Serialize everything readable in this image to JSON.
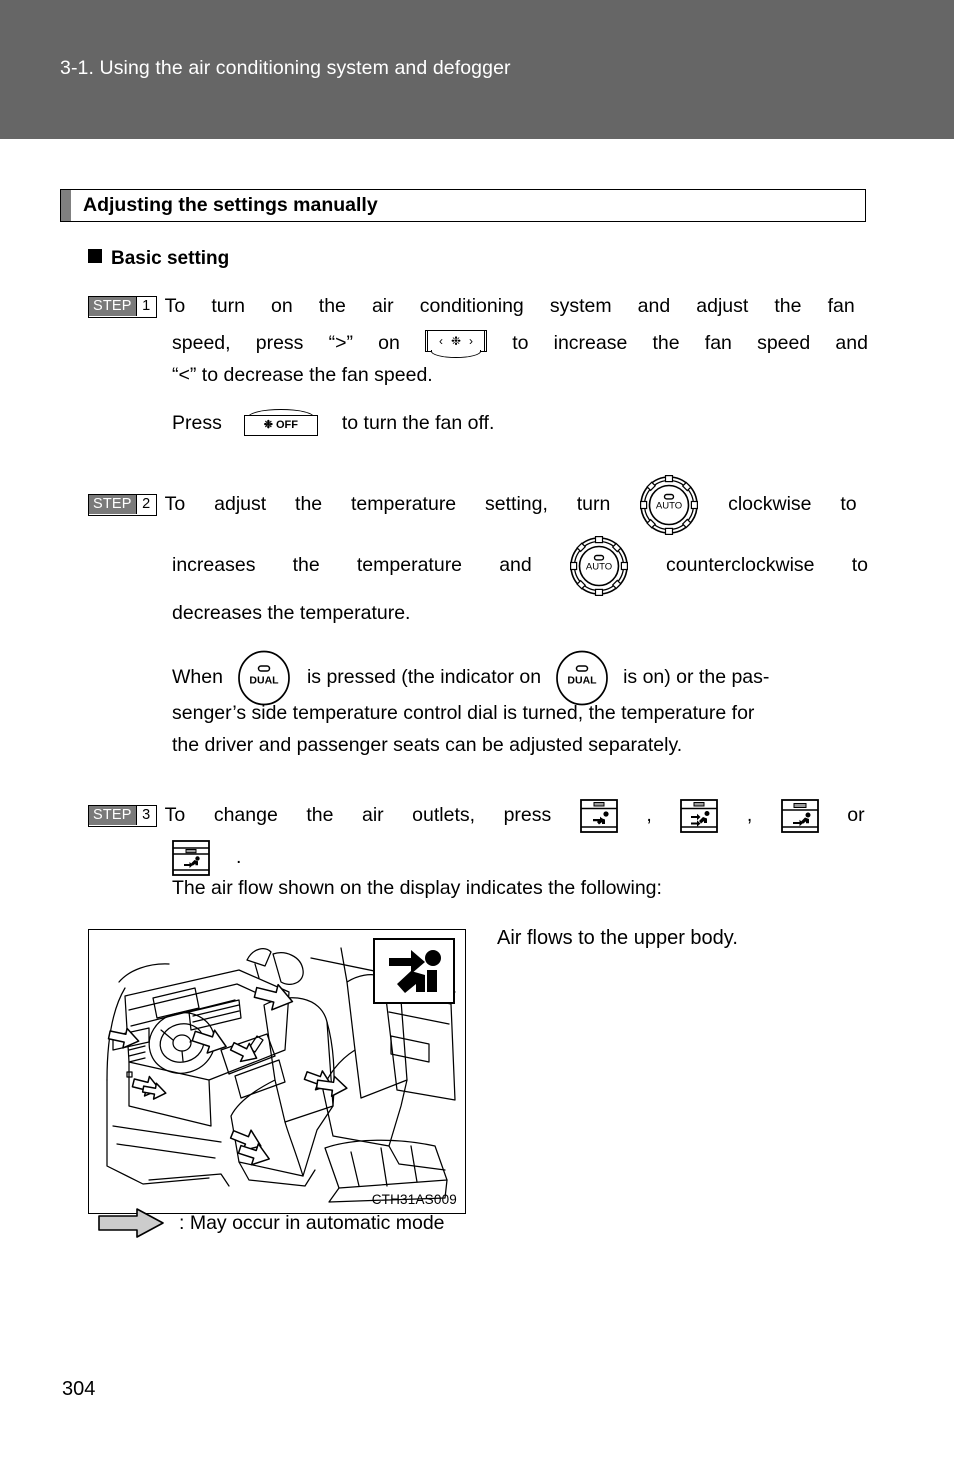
{
  "header": {
    "chapter_title": "3-1. Using the air conditioning system and defogger",
    "band_color": "#666666"
  },
  "section": {
    "title": "Adjusting the settings manually",
    "tab_color": "#808080"
  },
  "subheading": {
    "text": "Basic setting",
    "bullet": "filled-square"
  },
  "steps": [
    {
      "badge_word": "STEP",
      "badge_num": "1",
      "line1_a": "To",
      "line1_b": "turn",
      "line1_c": "on",
      "line1_d": "the",
      "line1_e": "air",
      "line1_f": "conditioning",
      "line1_g": "system",
      "line1_h": "and",
      "line1_i": "adjust",
      "line1_j": "the",
      "line1_k": "fan",
      "line2_a": "speed,",
      "line2_b": "press",
      "line2_c": "“>”",
      "line2_d": "on",
      "line2_e": "to",
      "line2_f": "increase",
      "line2_g": "the",
      "line2_h": "fan",
      "line2_i": "speed",
      "line2_j": "and",
      "line3": "“<” to decrease the fan speed.",
      "line4_a": "Press",
      "line4_b": "to turn the fan off."
    },
    {
      "badge_word": "STEP",
      "badge_num": "2",
      "line1_a": "To",
      "line1_b": "adjust",
      "line1_c": "the",
      "line1_d": "temperature",
      "line1_e": "setting,",
      "line1_f": "turn",
      "line1_g": "clockwise",
      "line1_h": "to",
      "line2_a": "increases",
      "line2_b": "the",
      "line2_c": "temperature",
      "line2_d": "and",
      "line2_e": "counterclockwise",
      "line2_f": "to",
      "line3": "decreases the temperature.",
      "note_a": "When",
      "note_b": "is pressed (the indicator on",
      "note_c": "is on) or the pas-",
      "note_line2": "senger’s side temperature control dial is turned, the temperature for",
      "note_line3": "the driver and passenger seats can be adjusted separately."
    },
    {
      "badge_word": "STEP",
      "badge_num": "3",
      "line1_a": "To",
      "line1_b": "change",
      "line1_c": "the",
      "line1_d": "air",
      "line1_e": "outlets,",
      "line1_f": "press",
      "comma1": ",",
      "comma2": ",",
      "or_word": "or",
      "period": ".",
      "line3": "The air flow shown on the display indicates the following:"
    }
  ],
  "icons": {
    "fan_rocker": {
      "name": "fan-speed-rocker",
      "left_glyph": "‹",
      "fan_glyph": "❉",
      "right_glyph": "›"
    },
    "fan_off": {
      "name": "fan-off-button",
      "fan_glyph": "❉",
      "label": "OFF"
    },
    "auto_dial": {
      "name": "auto-temperature-dial",
      "label": "AUTO"
    },
    "dual_button": {
      "name": "dual-climate-button",
      "label": "DUAL"
    },
    "mode_buttons": [
      {
        "name": "airflow-mode-upper-body"
      },
      {
        "name": "airflow-mode-upper-and-feet"
      },
      {
        "name": "airflow-mode-feet"
      },
      {
        "name": "airflow-mode-feet-and-defog"
      }
    ]
  },
  "illustration": {
    "code": "CTH31AS009",
    "mode_icon": "airflow-upper-body-person",
    "caption": "Air flows to the upper body."
  },
  "legend": {
    "arrow": "gray-block-arrow",
    "text": ": May occur in automatic mode",
    "arrow_fill": "#c8c8c8"
  },
  "footer": {
    "page_number": "304"
  }
}
